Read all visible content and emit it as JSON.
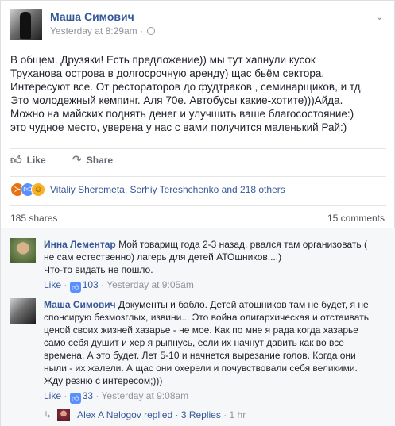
{
  "post": {
    "author": "Маша Симович",
    "timestamp": "Yesterday at 8:29am",
    "privacy_icon": "globe-icon",
    "body_lines": [
      "В общем. Друзяки! Есть предложение)) мы тут хапнули кусок",
      "Труханова острова в долгосрочную аренду) щас бьём сектора.",
      "Интересуют все. От рестораторов до фудтраков , семинарщиков, и тд.",
      "Это молодежный кемпинг. Аля 70е. Автобусы какие-хотите)))Айда.",
      "Можно на майских поднять денег и улучшить ваше благосостояние:)",
      "это чудное место, уверена у нас с вами получится маленький Рай:)"
    ]
  },
  "actions": {
    "like": "Like",
    "share": "Share"
  },
  "reactions": {
    "icons": [
      "angry-icon",
      "like-icon",
      "haha-icon"
    ],
    "text": "Vitaliy Sheremeta, Serhiy Tereshchenko and 218 others"
  },
  "stats": {
    "shares": "185 shares",
    "comments": "15 comments"
  },
  "comments": [
    {
      "author": "Инна Лементар",
      "lines": [
        " Мой товарищ года 2-3 назад, рвался там организовать (",
        "не сам естественно) лагерь для детей АТОшников....)",
        "Что-то видать не пошло."
      ],
      "like": "Like",
      "dot": "·",
      "likes": "103",
      "time": "Yesterday at 9:05am"
    },
    {
      "author": "Маша Симович",
      "lines": [
        " Документы и бабло. Детей атошников там не будет, я не",
        "спонсирую безмозглых, извини... Это война олигархическая и отстаивать",
        "ценой своих жизней хазарье - не мое. Как по мне я рада когда хазарье",
        "само себя душит и хер я рыпнусь, если их начнут давить как во все",
        "времена. А это будет. Лет 5-10 и начнется вырезание голов. Когда они",
        "ныли - их жалели. А щас они охерели и почувствовали себя великими.",
        "Жду резню с интересом;)))"
      ],
      "like": "Like",
      "dot": "·",
      "likes": "33",
      "time": "Yesterday at 9:08am"
    }
  ],
  "replies": {
    "text": "Alex A Nelogov replied · 3 Replies",
    "time": " · 1 hr"
  }
}
